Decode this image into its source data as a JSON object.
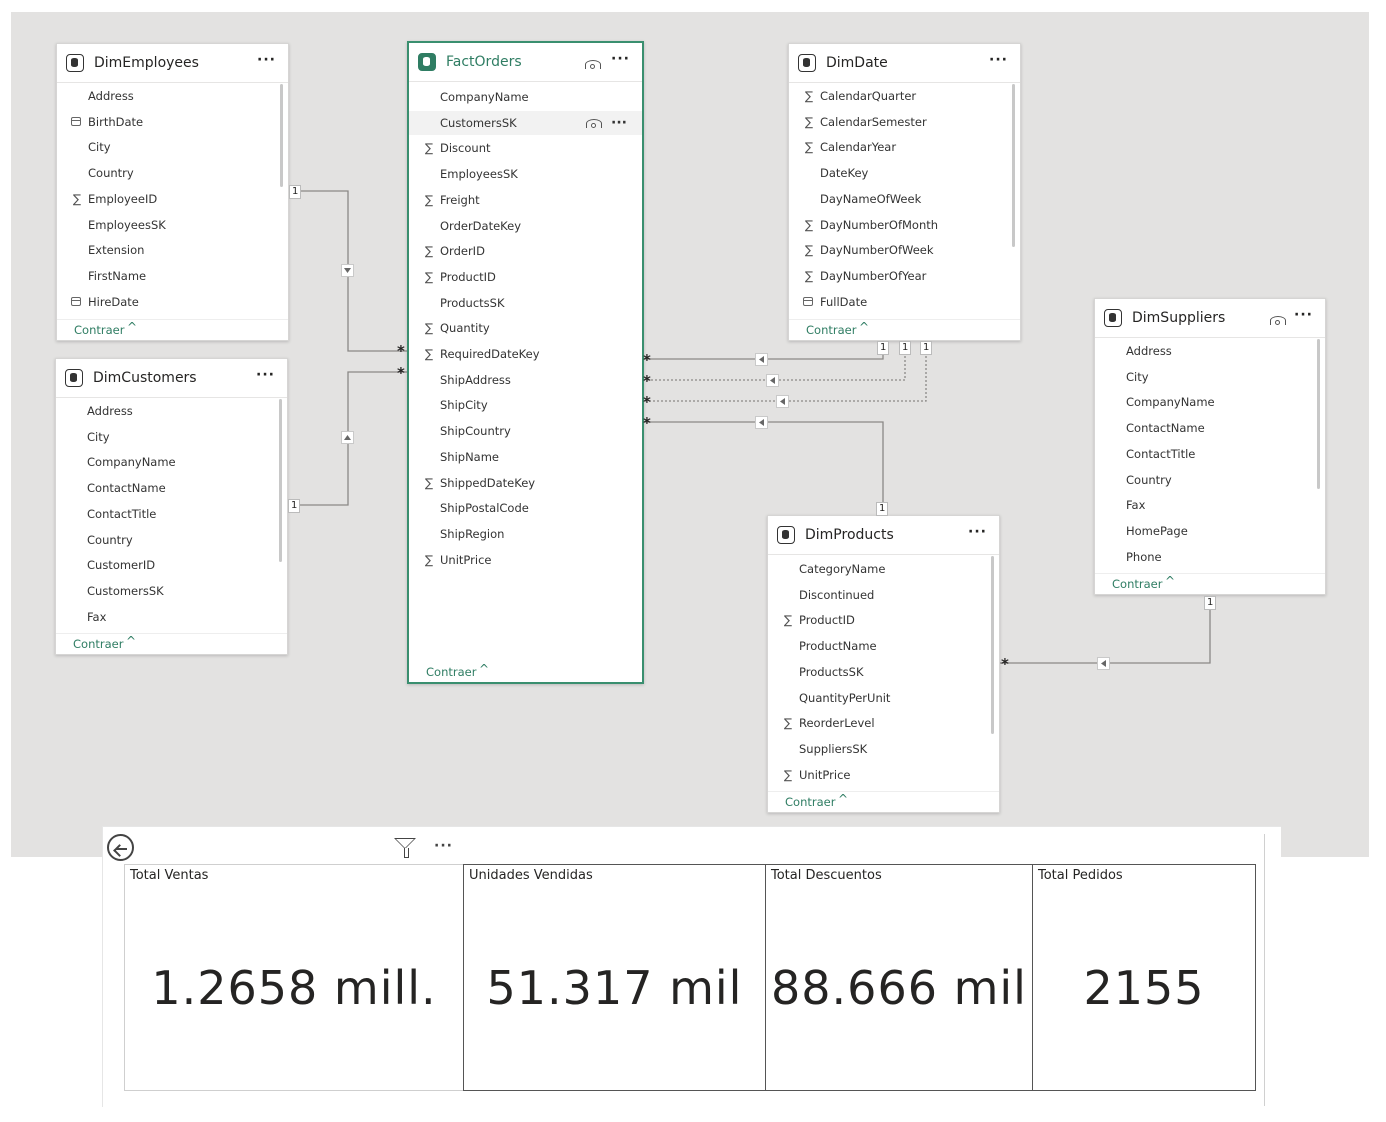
{
  "collapse_label": "Contraer",
  "tables": {
    "employees": {
      "title": "DimEmployees",
      "fields": [
        {
          "name": "Address",
          "icon": ""
        },
        {
          "name": "BirthDate",
          "icon": "cal"
        },
        {
          "name": "City",
          "icon": ""
        },
        {
          "name": "Country",
          "icon": ""
        },
        {
          "name": "EmployeeID",
          "icon": "sum"
        },
        {
          "name": "EmployeesSK",
          "icon": ""
        },
        {
          "name": "Extension",
          "icon": ""
        },
        {
          "name": "FirstName",
          "icon": ""
        },
        {
          "name": "HireDate",
          "icon": "cal"
        }
      ]
    },
    "customers": {
      "title": "DimCustomers",
      "fields": [
        {
          "name": "Address",
          "icon": ""
        },
        {
          "name": "City",
          "icon": ""
        },
        {
          "name": "CompanyName",
          "icon": ""
        },
        {
          "name": "ContactName",
          "icon": ""
        },
        {
          "name": "ContactTitle",
          "icon": ""
        },
        {
          "name": "Country",
          "icon": ""
        },
        {
          "name": "CustomerID",
          "icon": ""
        },
        {
          "name": "CustomersSK",
          "icon": ""
        },
        {
          "name": "Fax",
          "icon": ""
        }
      ]
    },
    "orders": {
      "title": "FactOrders",
      "fields": [
        {
          "name": "CompanyName",
          "icon": ""
        },
        {
          "name": "CustomersSK",
          "icon": ""
        },
        {
          "name": "Discount",
          "icon": "sum"
        },
        {
          "name": "EmployeesSK",
          "icon": ""
        },
        {
          "name": "Freight",
          "icon": "sum"
        },
        {
          "name": "OrderDateKey",
          "icon": ""
        },
        {
          "name": "OrderID",
          "icon": "sum"
        },
        {
          "name": "ProductID",
          "icon": "sum"
        },
        {
          "name": "ProductsSK",
          "icon": ""
        },
        {
          "name": "Quantity",
          "icon": "sum"
        },
        {
          "name": "RequiredDateKey",
          "icon": "sum"
        },
        {
          "name": "ShipAddress",
          "icon": ""
        },
        {
          "name": "ShipCity",
          "icon": ""
        },
        {
          "name": "ShipCountry",
          "icon": ""
        },
        {
          "name": "ShipName",
          "icon": ""
        },
        {
          "name": "ShippedDateKey",
          "icon": "sum"
        },
        {
          "name": "ShipPostalCode",
          "icon": ""
        },
        {
          "name": "ShipRegion",
          "icon": ""
        },
        {
          "name": "UnitPrice",
          "icon": "sum"
        }
      ]
    },
    "date": {
      "title": "DimDate",
      "fields": [
        {
          "name": "CalendarQuarter",
          "icon": "sum"
        },
        {
          "name": "CalendarSemester",
          "icon": "sum"
        },
        {
          "name": "CalendarYear",
          "icon": "sum"
        },
        {
          "name": "DateKey",
          "icon": ""
        },
        {
          "name": "DayNameOfWeek",
          "icon": ""
        },
        {
          "name": "DayNumberOfMonth",
          "icon": "sum"
        },
        {
          "name": "DayNumberOfWeek",
          "icon": "sum"
        },
        {
          "name": "DayNumberOfYear",
          "icon": "sum"
        },
        {
          "name": "FullDate",
          "icon": "cal"
        }
      ]
    },
    "suppliers": {
      "title": "DimSuppliers",
      "fields": [
        {
          "name": "Address",
          "icon": ""
        },
        {
          "name": "City",
          "icon": ""
        },
        {
          "name": "CompanyName",
          "icon": ""
        },
        {
          "name": "ContactName",
          "icon": ""
        },
        {
          "name": "ContactTitle",
          "icon": ""
        },
        {
          "name": "Country",
          "icon": ""
        },
        {
          "name": "Fax",
          "icon": ""
        },
        {
          "name": "HomePage",
          "icon": ""
        },
        {
          "name": "Phone",
          "icon": ""
        }
      ]
    },
    "products": {
      "title": "DimProducts",
      "fields": [
        {
          "name": "CategoryName",
          "icon": ""
        },
        {
          "name": "Discontinued",
          "icon": ""
        },
        {
          "name": "ProductID",
          "icon": "sum"
        },
        {
          "name": "ProductName",
          "icon": ""
        },
        {
          "name": "ProductsSK",
          "icon": ""
        },
        {
          "name": "QuantityPerUnit",
          "icon": ""
        },
        {
          "name": "ReorderLevel",
          "icon": "sum"
        },
        {
          "name": "SuppliersSK",
          "icon": ""
        },
        {
          "name": "UnitPrice",
          "icon": "sum"
        }
      ]
    }
  },
  "cardinality": {
    "one": "1",
    "many": "*"
  },
  "kpis": [
    {
      "title": "Total Ventas",
      "value": "1.2658 mill."
    },
    {
      "title": "Unidades Vendidas",
      "value": "51.317 mil"
    },
    {
      "title": "Total Descuentos",
      "value": "88.666 mil"
    },
    {
      "title": "Total Pedidos",
      "value": "2155"
    }
  ],
  "colors": {
    "accent": "#2f7d63",
    "canvas": "#e3e2e1",
    "line": "#8a8886"
  },
  "icons": {
    "table": "table-icon",
    "sum": "sigma-icon",
    "date": "calendar-icon",
    "visibility": "eye-icon",
    "more": "more-options-icon",
    "back": "back-arrow-icon",
    "filter": "filter-icon"
  }
}
